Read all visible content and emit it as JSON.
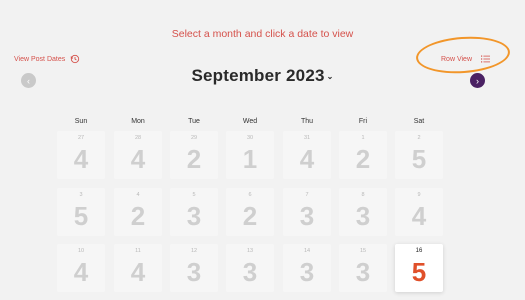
{
  "header": {
    "prompt": "Select a month and click a date to view",
    "past_link": "View Post Dates",
    "row_view": "Row View",
    "month_title": "September 2023",
    "caret": "⌄",
    "prev": "‹",
    "next": "›"
  },
  "weekdays": [
    "Sun",
    "Mon",
    "Tue",
    "Wed",
    "Thu",
    "Fri",
    "Sat"
  ],
  "weeks": [
    [
      {
        "day": "27",
        "count": "4"
      },
      {
        "day": "28",
        "count": "4"
      },
      {
        "day": "29",
        "count": "2"
      },
      {
        "day": "30",
        "count": "1"
      },
      {
        "day": "31",
        "count": "4"
      },
      {
        "day": "1",
        "count": "2"
      },
      {
        "day": "2",
        "count": "5"
      }
    ],
    [
      {
        "day": "3",
        "count": "5"
      },
      {
        "day": "4",
        "count": "2"
      },
      {
        "day": "5",
        "count": "3"
      },
      {
        "day": "6",
        "count": "2"
      },
      {
        "day": "7",
        "count": "3"
      },
      {
        "day": "8",
        "count": "3"
      },
      {
        "day": "9",
        "count": "4"
      }
    ],
    [
      {
        "day": "10",
        "count": "4"
      },
      {
        "day": "11",
        "count": "4"
      },
      {
        "day": "12",
        "count": "3"
      },
      {
        "day": "13",
        "count": "3"
      },
      {
        "day": "14",
        "count": "3"
      },
      {
        "day": "15",
        "count": "3"
      },
      {
        "day": "16",
        "count": "5",
        "selected": true
      }
    ]
  ],
  "colors": {
    "accent": "#d5514b",
    "selected_count": "#e0502a",
    "next_button": "#4a2163",
    "highlight_ring": "#f2962a"
  }
}
